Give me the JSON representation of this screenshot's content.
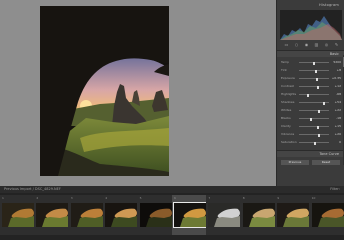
{
  "panel": {
    "histogram_title": "Histogram",
    "quick_develop_title": "Basic",
    "tools": [
      "crop-icon",
      "spot-icon",
      "redeye-icon",
      "gradient-icon",
      "radial-icon",
      "brush-icon"
    ],
    "sliders": [
      {
        "label": "Temp",
        "value": "5200"
      },
      {
        "label": "Tint",
        "value": "+8"
      },
      {
        "label": "Exposure",
        "value": "+0.35"
      },
      {
        "label": "Contrast",
        "value": "+12"
      },
      {
        "label": "Highlights",
        "value": "-68"
      },
      {
        "label": "Shadows",
        "value": "+54"
      },
      {
        "label": "Whites",
        "value": "+22"
      },
      {
        "label": "Blacks",
        "value": "-18"
      },
      {
        "label": "Clarity",
        "value": "+15"
      },
      {
        "label": "Vibrance",
        "value": "+20"
      },
      {
        "label": "Saturation",
        "value": "0"
      }
    ],
    "tone_curve_title": "Tone Curve",
    "prev_button": "Previous",
    "reset_button": "Reset"
  },
  "filmstrip": {
    "breadcrumb": "Previous Import  /  DSC_4829.NEF",
    "filter_label": "Filter:",
    "cells": [
      {
        "num": "1"
      },
      {
        "num": "2"
      },
      {
        "num": "3"
      },
      {
        "num": "4"
      },
      {
        "num": "5"
      },
      {
        "num": "6",
        "selected": true
      },
      {
        "num": "7"
      },
      {
        "num": "8"
      },
      {
        "num": "9"
      },
      {
        "num": "10"
      }
    ]
  },
  "colors": {
    "accent": "#f2b24a",
    "panel": "#3b3b3b",
    "canvas": "#8e8e8e"
  }
}
